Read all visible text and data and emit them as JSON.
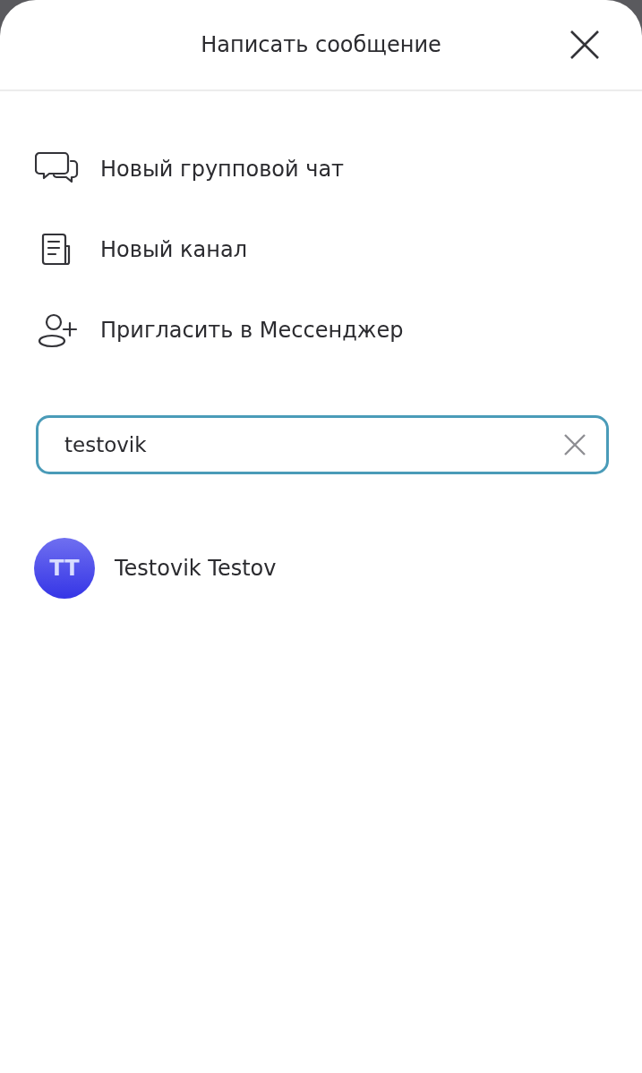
{
  "header": {
    "title": "Написать сообщение"
  },
  "actions": [
    {
      "kind": "group_chat",
      "label": "Новый групповой чат"
    },
    {
      "kind": "channel",
      "label": "Новый канал"
    },
    {
      "kind": "invite",
      "label": "Пригласить в Мессенджер"
    }
  ],
  "search": {
    "value": "testovik"
  },
  "contacts": [
    {
      "initials": "TT",
      "name": "Testovik Testov"
    }
  ]
}
